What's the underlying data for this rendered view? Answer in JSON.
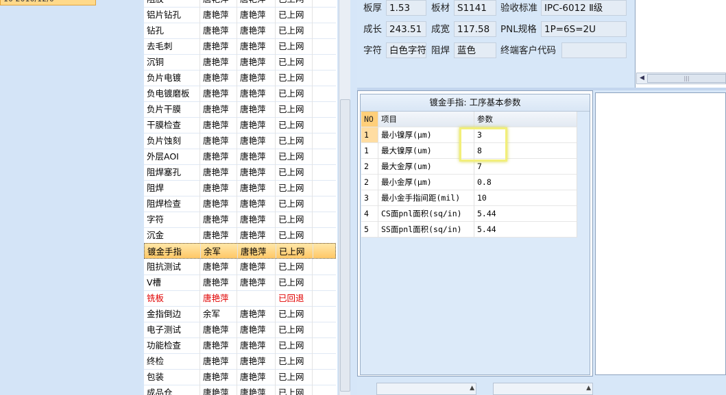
{
  "left_panel": {
    "selected_text": "10 2010/12/0"
  },
  "process_list": {
    "rows": [
      {
        "name": "阻胶",
        "c1": "唐艳萍",
        "c2": "唐艳萍",
        "status": "已上网"
      },
      {
        "name": "铝片钻孔",
        "c1": "唐艳萍",
        "c2": "唐艳萍",
        "status": "已上网"
      },
      {
        "name": "钻孔",
        "c1": "唐艳萍",
        "c2": "唐艳萍",
        "status": "已上网"
      },
      {
        "name": "去毛刺",
        "c1": "唐艳萍",
        "c2": "唐艳萍",
        "status": "已上网"
      },
      {
        "name": "沉铜",
        "c1": "唐艳萍",
        "c2": "唐艳萍",
        "status": "已上网"
      },
      {
        "name": "负片电镀",
        "c1": "唐艳萍",
        "c2": "唐艳萍",
        "status": "已上网"
      },
      {
        "name": "负电镀磨板",
        "c1": "唐艳萍",
        "c2": "唐艳萍",
        "status": "已上网"
      },
      {
        "name": "负片干膜",
        "c1": "唐艳萍",
        "c2": "唐艳萍",
        "status": "已上网"
      },
      {
        "name": "干膜检查",
        "c1": "唐艳萍",
        "c2": "唐艳萍",
        "status": "已上网"
      },
      {
        "name": "负片蚀刻",
        "c1": "唐艳萍",
        "c2": "唐艳萍",
        "status": "已上网"
      },
      {
        "name": "外层AOI",
        "c1": "唐艳萍",
        "c2": "唐艳萍",
        "status": "已上网"
      },
      {
        "name": "阻焊塞孔",
        "c1": "唐艳萍",
        "c2": "唐艳萍",
        "status": "已上网"
      },
      {
        "name": "阻焊",
        "c1": "唐艳萍",
        "c2": "唐艳萍",
        "status": "已上网"
      },
      {
        "name": "阻焊检查",
        "c1": "唐艳萍",
        "c2": "唐艳萍",
        "status": "已上网"
      },
      {
        "name": "字符",
        "c1": "唐艳萍",
        "c2": "唐艳萍",
        "status": "已上网"
      },
      {
        "name": "沉金",
        "c1": "唐艳萍",
        "c2": "唐艳萍",
        "status": "已上网"
      },
      {
        "name": "镀金手指",
        "c1": "余军",
        "c2": "唐艳萍",
        "status": "已上网",
        "selected": true
      },
      {
        "name": "阻抗测试",
        "c1": "唐艳萍",
        "c2": "唐艳萍",
        "status": "已上网"
      },
      {
        "name": "V槽",
        "c1": "唐艳萍",
        "c2": "唐艳萍",
        "status": "已上网"
      },
      {
        "name": "铣板",
        "c1": "唐艳萍",
        "c2": "",
        "status": "已回退",
        "red": true
      },
      {
        "name": "金指倒边",
        "c1": "余军",
        "c2": "唐艳萍",
        "status": "已上网"
      },
      {
        "name": "电子测试",
        "c1": "唐艳萍",
        "c2": "唐艳萍",
        "status": "已上网"
      },
      {
        "name": "功能检查",
        "c1": "唐艳萍",
        "c2": "唐艳萍",
        "status": "已上网"
      },
      {
        "name": "终检",
        "c1": "唐艳萍",
        "c2": "唐艳萍",
        "status": "已上网"
      },
      {
        "name": "包装",
        "c1": "唐艳萍",
        "c2": "唐艳萍",
        "status": "已上网"
      },
      {
        "name": "成品仓",
        "c1": "唐艳萍",
        "c2": "唐艳萍",
        "status": "已上网"
      }
    ]
  },
  "info": {
    "board_thickness_label": "板厚",
    "board_thickness": "1.53",
    "material_label": "板材",
    "material": "S1141",
    "standard_label": "验收标准",
    "standard": "IPC-6012 Ⅱ级",
    "length_label": "成长",
    "length": "243.51",
    "width_label": "成宽",
    "width": "117.58",
    "pnl_label": "PNL规格",
    "pnl": "1P=6S=2U",
    "char_label": "字符",
    "char_value": "白色字符",
    "mask_label": "阻焊",
    "mask_value": "蓝色",
    "customer_code_label": "终端客户代码",
    "customer_code": ""
  },
  "param_table": {
    "title": "镀金手指: 工序基本参数",
    "headers": {
      "no": "NO",
      "item": "项目",
      "value": "参数"
    },
    "rows": [
      {
        "no": "1",
        "item": "最小镍厚(μm)",
        "value": "3"
      },
      {
        "no": "1",
        "item": "最大镍厚(um)",
        "value": "8"
      },
      {
        "no": "2",
        "item": "最大金厚(um)",
        "value": "7"
      },
      {
        "no": "2",
        "item": "最小金厚(μm)",
        "value": "0.8"
      },
      {
        "no": "3",
        "item": "最小金手指间距(mil)",
        "value": "10"
      },
      {
        "no": "4",
        "item": "CS面pnl面积(sq/in)",
        "value": "5.44"
      },
      {
        "no": "5",
        "item": "SS面pnl面积(sq/in)",
        "value": "5.44"
      }
    ]
  },
  "icons": {
    "scroll_left": "arrow-left-icon",
    "grip": "scroll-grip-icon",
    "dropdown": "chevron-up-icon"
  },
  "colors": {
    "selection": "#ffc867",
    "rollback_text": "#e00000",
    "highlight": "#f2ef7a"
  }
}
